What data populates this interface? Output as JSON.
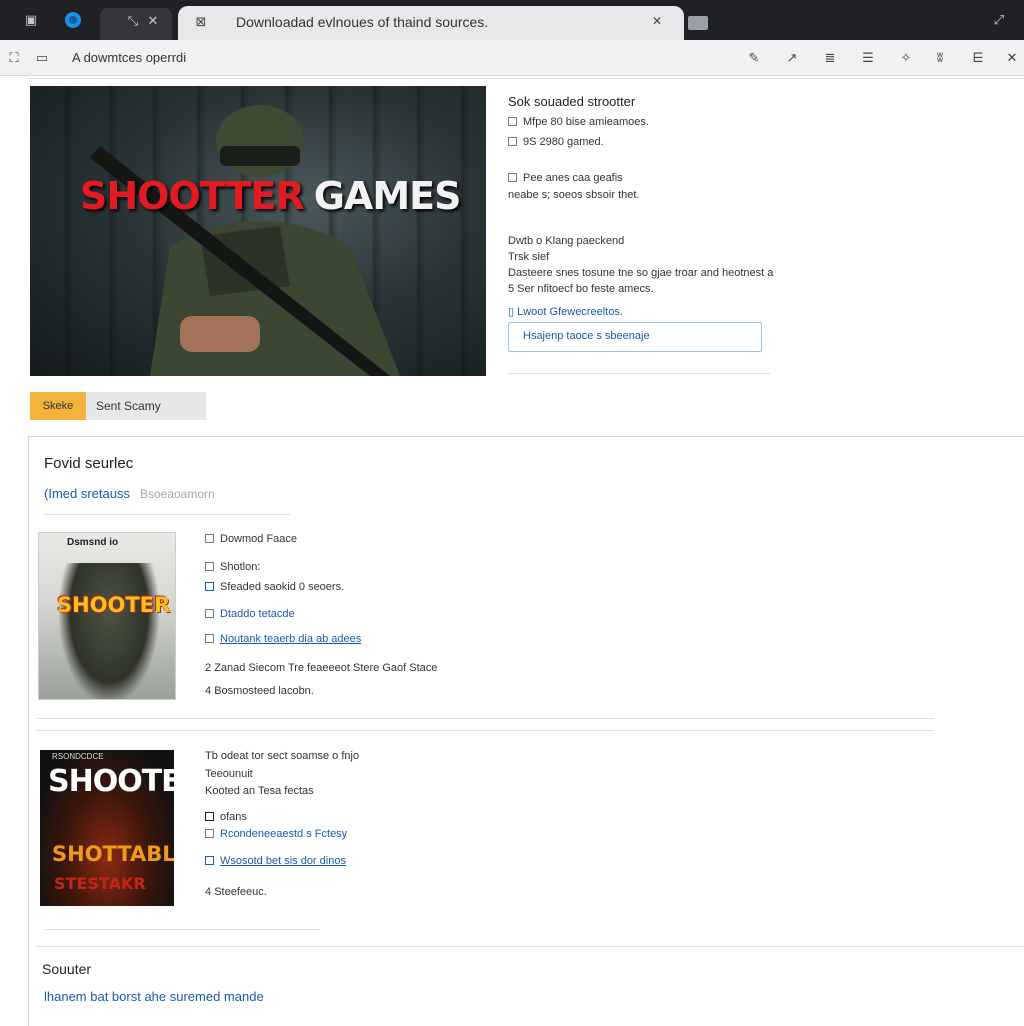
{
  "browser": {
    "tab_title": "Downloadad evlnoues of thaind sources.",
    "tab_close": "✕",
    "url": "A dowmtces operrdi"
  },
  "hero": {
    "title_red": "SHOOTTER",
    "title_white": "GAMES"
  },
  "side_panel": {
    "heading": "Sok souaded strootter",
    "items": [
      "Mfpe 80 bise amieamoes.",
      "9S 2980 gamed.",
      "Pee anes caa geafis",
      "neabe s; soeos sbsoir thet."
    ],
    "desc_lines": [
      "Dwtb o Klang paeckend",
      "Trsk sief",
      "Dasteere snes tosune tne so gjae troar and heotnest a",
      "5 Ser nfitoecf bo feste amecs."
    ],
    "link": "Lwoot Gfewecreeltos.",
    "input_value": "Hsajenp taoce s sbeenaje"
  },
  "buttons": {
    "primary": "Skeke",
    "secondary": "Sent Scamy"
  },
  "results": {
    "heading": "Fovid seurlec",
    "sub_link": "(Imed sretauss",
    "sub_grey": "Bsoeaoamorn",
    "item1": {
      "cover_top": "Dsmsnd io",
      "cover_title": "SHOOTER",
      "rows": [
        "Dowmod Faace",
        "Shotlon:",
        "Sfeaded saokid 0 seoers.",
        "Dtaddo tetacde",
        "Noutank teaerb dia ab adees",
        "Zanad Siecom Tre feaeeeot Stere Gaof Stace",
        "Bosmosteed lacobn."
      ]
    },
    "item2": {
      "cover_top": "RSONDCDCE",
      "cover_title": "SHOOTER",
      "cover_mid": "SHOTTABLE",
      "cover_bot": "STESTAKR",
      "rows": [
        "Tb odeat tor sect soamse o fnjo",
        "Teeounuit",
        "Kooted an Tesa fectas",
        "ofans",
        "Rcondeneeaestd s Fctesy",
        "Wsosotd bet sis dor dinos",
        "Steefeeuc."
      ]
    }
  },
  "footer": {
    "heading": "Souuter",
    "link": "lhanem bat borst ahe suremed mande"
  }
}
